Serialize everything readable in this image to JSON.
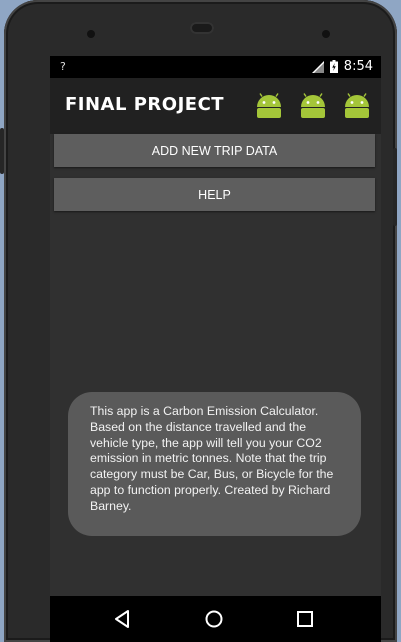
{
  "status_bar": {
    "left_indicator": "?",
    "time": "8:54"
  },
  "app_bar": {
    "title": "FINAL PROJECT",
    "icons": [
      "android-icon",
      "android-icon",
      "android-icon"
    ],
    "icon_color": "#a4c639"
  },
  "buttons": {
    "add_trip": "ADD NEW TRIP DATA",
    "help": "HELP"
  },
  "toast": {
    "message": "This app is a Carbon Emission Calculator. Based on the distance travelled and the vehicle type, the app will tell you your CO2 emission in metric tonnes. Note that the trip category must be Car, Bus, or Bicycle for the app to function properly. Created by Richard Barney."
  },
  "nav_bar": {
    "icons": [
      "back-icon",
      "home-icon",
      "recents-icon"
    ]
  }
}
